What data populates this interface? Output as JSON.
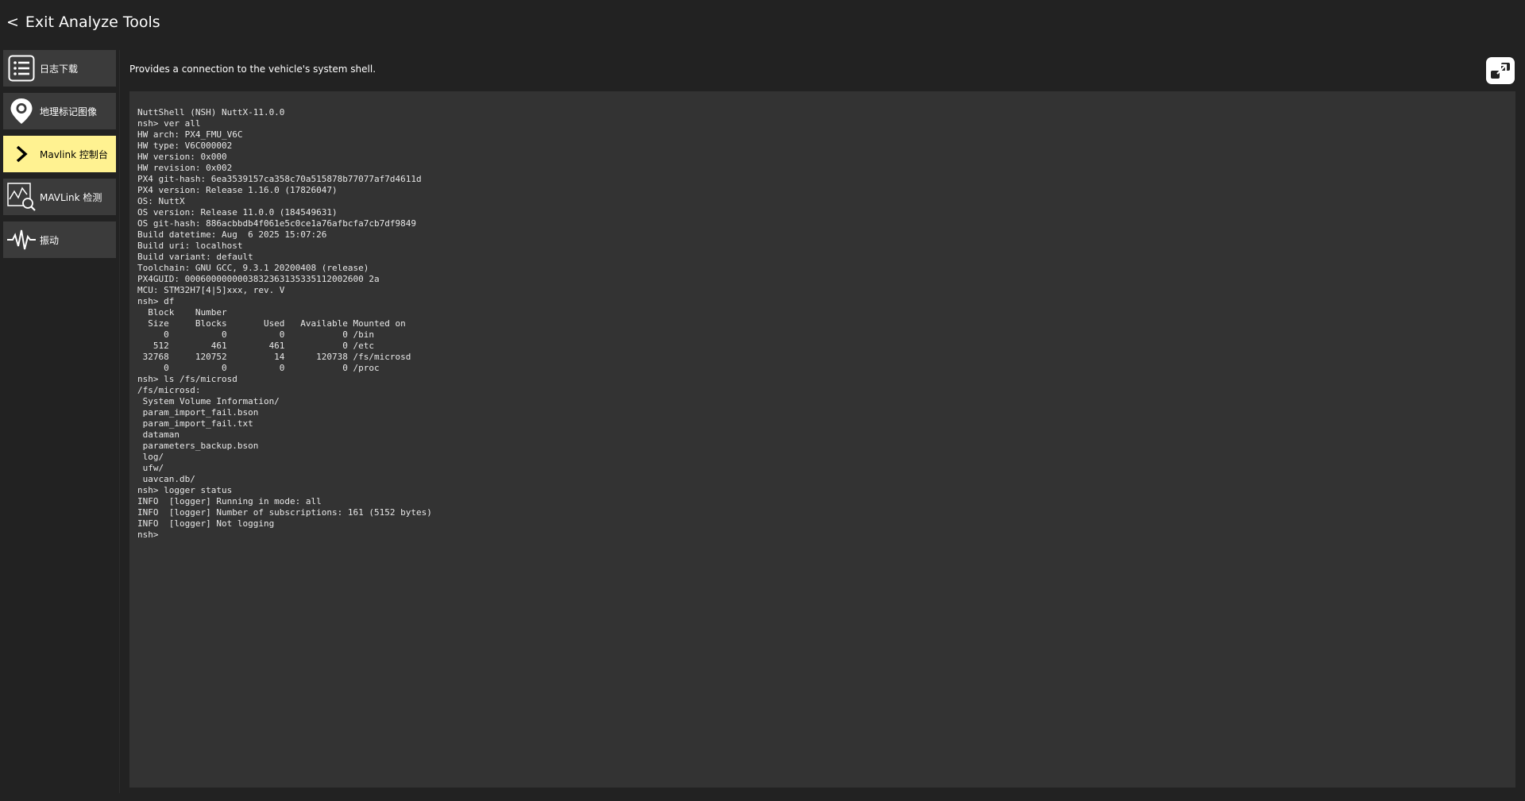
{
  "header": {
    "back_chevron": "<",
    "back_label": "Exit Analyze Tools"
  },
  "sidebar": {
    "items": [
      {
        "label": "日志下载",
        "icon": "list-icon"
      },
      {
        "label": "地理标记图像",
        "icon": "map-pin-icon"
      },
      {
        "label": "Mavlink 控制台",
        "icon": "chevron-right-icon"
      },
      {
        "label": "MAVLink 检测",
        "icon": "chart-inspect-icon"
      },
      {
        "label": "振动",
        "icon": "waveform-icon"
      }
    ],
    "active_index": 2
  },
  "description": "Provides a connection to the vehicle's system shell.",
  "colors": {
    "background": "#222222",
    "sidebar_item": "#3b3b3b",
    "active_item": "#fff291",
    "console_bg": "#333333"
  },
  "console": {
    "lines": [
      "NuttShell (NSH) NuttX-11.0.0",
      "nsh> ver all",
      "HW arch: PX4_FMU_V6C",
      "HW type: V6C000002",
      "HW version: 0x000",
      "HW revision: 0x002",
      "PX4 git-hash: 6ea3539157ca358c70a515878b77077af7d4611d",
      "PX4 version: Release 1.16.0 (17826047)",
      "OS: NuttX",
      "OS version: Release 11.0.0 (184549631)",
      "OS git-hash: 886acbbdb4f061e5c0ce1a76afbcfa7cb7df9849",
      "Build datetime: Aug  6 2025 15:07:26",
      "Build uri: localhost",
      "Build variant: default",
      "Toolchain: GNU GCC, 9.3.1 20200408 (release)",
      "PX4GUID: 0006000000003832363135335112002600 2a",
      "MCU: STM32H7[4|5]xxx, rev. V",
      "nsh> df",
      "  Block    Number",
      "  Size     Blocks       Used   Available Mounted on",
      "     0          0          0           0 /bin",
      "   512        461        461           0 /etc",
      " 32768     120752         14      120738 /fs/microsd",
      "     0          0          0           0 /proc",
      "nsh> ls /fs/microsd",
      "/fs/microsd:",
      " System Volume Information/",
      " param_import_fail.bson",
      " param_import_fail.txt",
      " dataman",
      " parameters_backup.bson",
      " log/",
      " ufw/",
      " uavcan.db/",
      "nsh> logger status",
      "INFO  [logger] Running in mode: all",
      "INFO  [logger] Number of subscriptions: 161 (5152 bytes)",
      "INFO  [logger] Not logging",
      "nsh>"
    ]
  }
}
